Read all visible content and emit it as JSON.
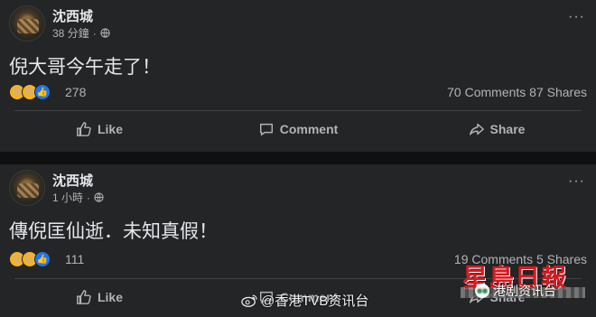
{
  "posts": [
    {
      "author": "沈西城",
      "time": "38 分鐘",
      "privacy_icon": "globe-icon",
      "text": "倪大哥今午走了！",
      "reactions": [
        "sad",
        "wow",
        "like"
      ],
      "reaction_count": "278",
      "counts": "70 Comments  87 Shares",
      "actions": [
        "Like",
        "Comment",
        "Share"
      ]
    },
    {
      "author": "沈西城",
      "time": "1 小時",
      "privacy_icon": "globe-icon",
      "text": "傳倪匡仙逝．未知真假！",
      "reactions": [
        "wow",
        "sad",
        "like"
      ],
      "reaction_count": "111",
      "counts": "19 Comments  5 Shares",
      "actions": [
        "Like",
        "Comment",
        "Share"
      ]
    }
  ],
  "overlay": {
    "watermark": "@香港TVB资讯台",
    "logo": "星島日報",
    "badge": "港剧资讯台"
  },
  "colors": {
    "page_bg": "#101011",
    "card_bg": "#242526",
    "text_primary": "#e4e6eb",
    "text_secondary": "#b0b3b8",
    "logo_red": "#d71920"
  }
}
